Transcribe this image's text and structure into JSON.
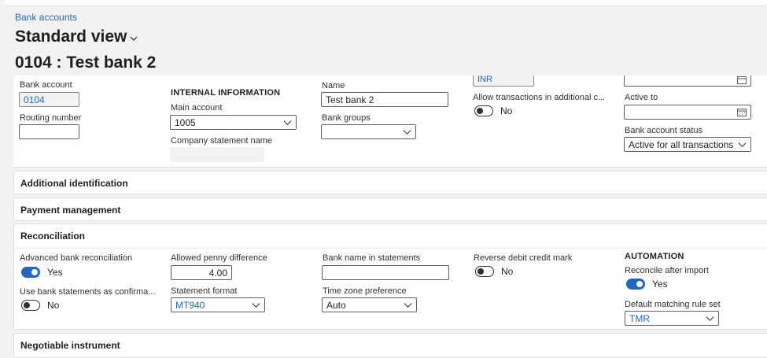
{
  "breadcrumb": "Bank accounts",
  "view_title": "Standard view",
  "record_title": "0104 : Test bank 2",
  "general": {
    "bank_account_label": "Bank account",
    "bank_account_value": "0104",
    "routing_number_label": "Routing number",
    "routing_number_value": "",
    "internal_info_header": "INTERNAL INFORMATION",
    "main_account_label": "Main account",
    "main_account_value": "1005",
    "company_statement_name_label": "Company statement name",
    "company_statement_name_value": "",
    "name_label": "Name",
    "name_value": "Test bank 2",
    "bank_groups_label": "Bank groups",
    "bank_groups_value": "",
    "currency_partial_value": "INR",
    "allow_transactions_label": "Allow transactions in additional c...",
    "allow_transactions_state": "No",
    "active_to_label": "Active to",
    "active_to_value": "",
    "bank_account_status_label": "Bank account status",
    "bank_account_status_value": "Active for all transactions"
  },
  "fasttabs": {
    "additional_identification": "Additional identification",
    "payment_management": "Payment management",
    "reconciliation": "Reconciliation",
    "negotiable_instrument": "Negotiable instrument"
  },
  "reconciliation": {
    "advanced_label": "Advanced bank reconciliation",
    "advanced_state": "Yes",
    "use_statements_label": "Use bank statements as confirma...",
    "use_statements_state": "No",
    "allowed_penny_label": "Allowed penny difference",
    "allowed_penny_value": "4.00",
    "statement_format_label": "Statement format",
    "statement_format_value": "MT940",
    "bank_name_label": "Bank name in statements",
    "bank_name_value": "",
    "time_zone_label": "Time zone preference",
    "time_zone_value": "Auto",
    "reverse_debit_label": "Reverse debit credit mark",
    "reverse_debit_state": "No",
    "automation_header": "AUTOMATION",
    "reconcile_after_import_label": "Reconcile after import",
    "reconcile_after_import_state": "Yes",
    "default_matching_label": "Default matching rule set",
    "default_matching_value": "TMR"
  },
  "colors": {
    "accent": "#2266c4",
    "background": "#f3f2f1",
    "card": "#ffffff"
  },
  "icons": {
    "view_chevron": "chevron-down-icon",
    "dropdown": "chevron-down-icon",
    "date": "calendar-icon"
  }
}
